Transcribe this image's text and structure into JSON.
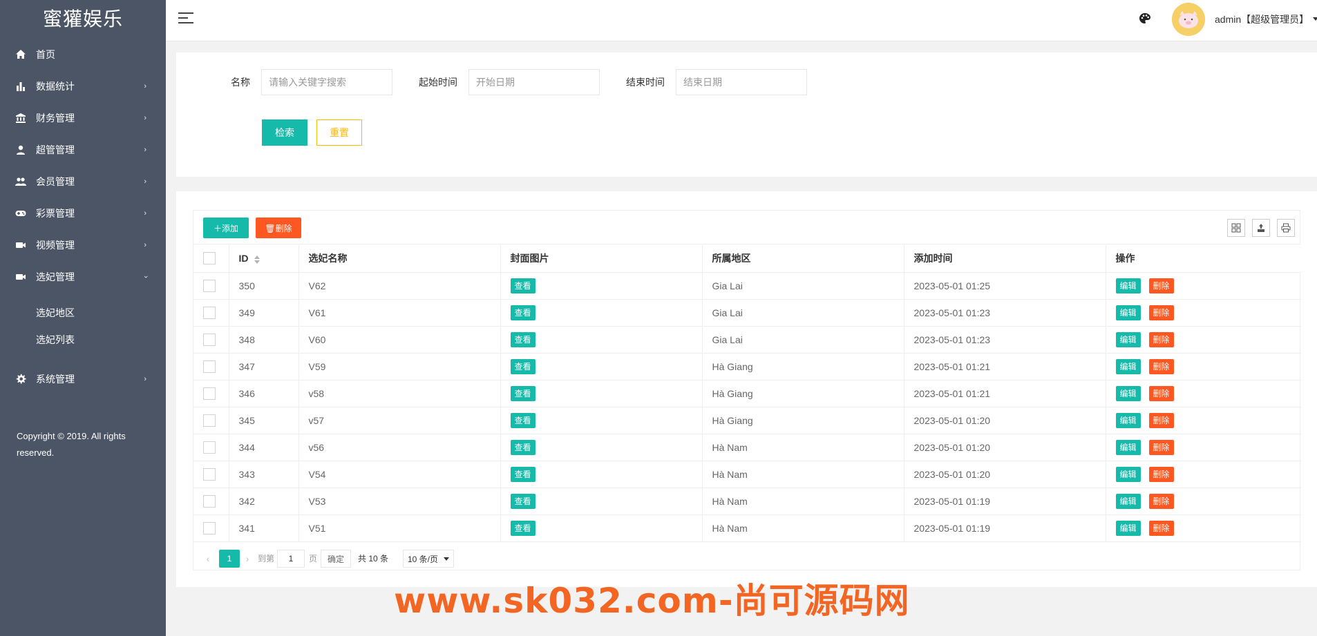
{
  "app": {
    "title": "蜜獾娱乐"
  },
  "sidebar": {
    "items": [
      {
        "label": "首页",
        "icon": "home-icon"
      },
      {
        "label": "数据统计",
        "icon": "bar-chart-icon"
      },
      {
        "label": "财务管理",
        "icon": "bank-icon"
      },
      {
        "label": "超管管理",
        "icon": "user-icon"
      },
      {
        "label": "会员管理",
        "icon": "users-icon"
      },
      {
        "label": "彩票管理",
        "icon": "gamepad-icon"
      },
      {
        "label": "视频管理",
        "icon": "video-icon"
      },
      {
        "label": "选妃管理",
        "icon": "video-icon"
      }
    ],
    "sub_items": [
      {
        "label": "选妃地区"
      },
      {
        "label": "选妃列表"
      }
    ],
    "system": {
      "label": "系统管理",
      "icon": "gear-icon"
    },
    "copyright": "Copyright © 2019. All rights reserved."
  },
  "header": {
    "user": "admin【超级管理员】"
  },
  "search": {
    "name_label": "名称",
    "name_placeholder": "请输入关键字搜索",
    "start_label": "起始时间",
    "start_placeholder": "开始日期",
    "end_label": "结束时间",
    "end_placeholder": "结束日期",
    "search_button": "检索",
    "reset_button": "重置"
  },
  "toolbar": {
    "add_label": "添加",
    "delete_label": "删除"
  },
  "table": {
    "columns": [
      "ID",
      "选妃名称",
      "封面图片",
      "所属地区",
      "添加时间",
      "操作"
    ],
    "view_label": "查看",
    "edit_label": "编辑",
    "delete_label": "删除",
    "rows": [
      {
        "id": "350",
        "name": "V62",
        "region": "Gia Lai",
        "time": "2023-05-01 01:25"
      },
      {
        "id": "349",
        "name": "V61",
        "region": "Gia Lai",
        "time": "2023-05-01 01:23"
      },
      {
        "id": "348",
        "name": "V60",
        "region": "Gia Lai",
        "time": "2023-05-01 01:23"
      },
      {
        "id": "347",
        "name": "V59",
        "region": "Hà Giang",
        "time": "2023-05-01 01:21"
      },
      {
        "id": "346",
        "name": "v58",
        "region": "Hà Giang",
        "time": "2023-05-01 01:21"
      },
      {
        "id": "345",
        "name": "v57",
        "region": "Hà Giang",
        "time": "2023-05-01 01:20"
      },
      {
        "id": "344",
        "name": "v56",
        "region": "Hà Nam",
        "time": "2023-05-01 01:20"
      },
      {
        "id": "343",
        "name": "V54",
        "region": "Hà Nam",
        "time": "2023-05-01 01:20"
      },
      {
        "id": "342",
        "name": "V53",
        "region": "Hà Nam",
        "time": "2023-05-01 01:19"
      },
      {
        "id": "341",
        "name": "V51",
        "region": "Hà Nam",
        "time": "2023-05-01 01:19"
      }
    ]
  },
  "pagination": {
    "current": "1",
    "goto_label": "到第",
    "goto_value": "1",
    "page_label": "页",
    "confirm_label": "确定",
    "total": "共 10 条",
    "per_page": "10 条/页"
  },
  "watermark": "www.sk032.com-尚可源码网",
  "colors": {
    "sidebar": "#4c5566",
    "primary": "#16baaa",
    "danger": "#ff5722",
    "warning": "#ffb800",
    "watermark": "#f26522"
  }
}
